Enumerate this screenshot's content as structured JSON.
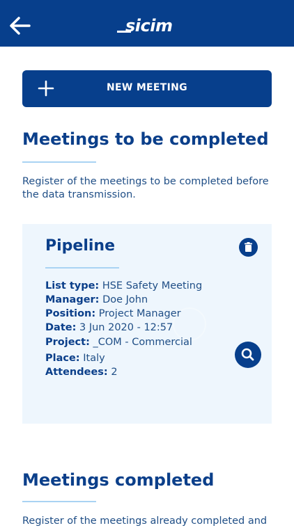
{
  "header": {
    "logo_text": "sicim"
  },
  "new_meeting_button": {
    "label": "NEW MEETING"
  },
  "section_to_complete": {
    "title": "Meetings to be completed",
    "description": "Register of the meetings to be completed before the data transmission."
  },
  "meeting_card": {
    "title": "Pipeline",
    "fields": [
      {
        "label": "List type:",
        "value": "HSE Safety Meeting"
      },
      {
        "label": "Manager:",
        "value": "Doe John"
      },
      {
        "label": "Position:",
        "value": "Project Manager"
      },
      {
        "label": "Date:",
        "value": "3 Jun 2020 - 12:57"
      },
      {
        "label": "Project:",
        "value": "_COM - Commercial"
      },
      {
        "label": "Place:",
        "value": "Italy"
      },
      {
        "label": "Attendees:",
        "value": "2"
      }
    ],
    "icons": {
      "delete": "trash-icon",
      "view": "search-icon"
    }
  },
  "section_completed": {
    "title": "Meetings completed",
    "description": "Register of the meetings already completed and"
  },
  "colors": {
    "primary": "#073f8c",
    "accent_rule": "#a9d3f3",
    "card_bg": "#eef6fd"
  }
}
